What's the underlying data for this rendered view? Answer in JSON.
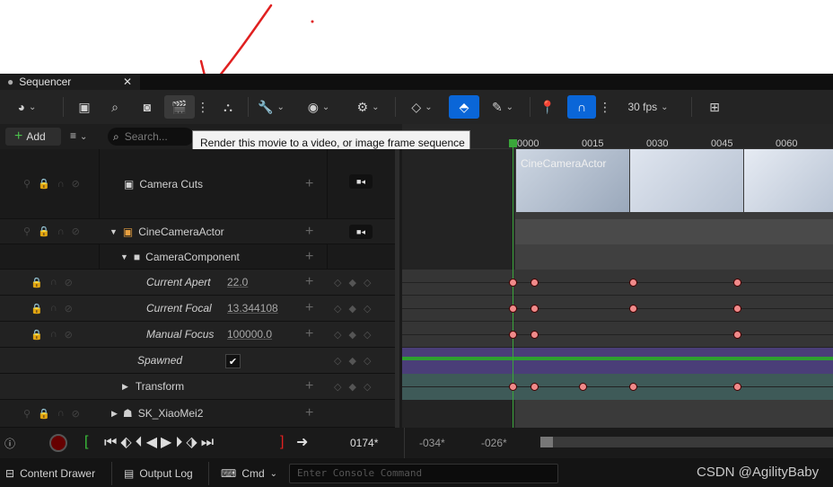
{
  "tab": {
    "title": "Sequencer"
  },
  "toolbar": {
    "fps": "30 fps"
  },
  "tooltip": "Render this movie to a video, or image frame sequence",
  "row2": {
    "add_label": "Add",
    "search_placeholder": "Search..."
  },
  "ruler": {
    "ticks": [
      "0000",
      "0015",
      "0030",
      "0045",
      "0060"
    ]
  },
  "tracks": {
    "camera_cuts": "Camera Cuts",
    "cine_camera": "CineCameraActor",
    "camera_component": "CameraComponent",
    "current_aperture": "Current Apert",
    "current_aperture_value": "22.0",
    "current_focal": "Current Focal",
    "current_focal_value": "13.344108",
    "manual_focus": "Manual Focus",
    "manual_focus_value": "100000.0",
    "spawned": "Spawned",
    "transform": "Transform",
    "sk": "SK_XiaoMei2",
    "clip_label": "CineCameraActor"
  },
  "transport": {
    "current_frame": "0174*",
    "start_frame": "-034*",
    "end_frame": "-026*"
  },
  "statusbar": {
    "content_drawer": "Content Drawer",
    "output_log": "Output Log",
    "cmd": "Cmd",
    "console_placeholder": "Enter Console Command",
    "watermark": "CSDN @AgilityBaby"
  },
  "colors": {
    "accent_blue": "#0a66d8",
    "keyframe": "#f08a8a",
    "playhead": "#3aa63a",
    "annotation_red": "#e02020"
  }
}
